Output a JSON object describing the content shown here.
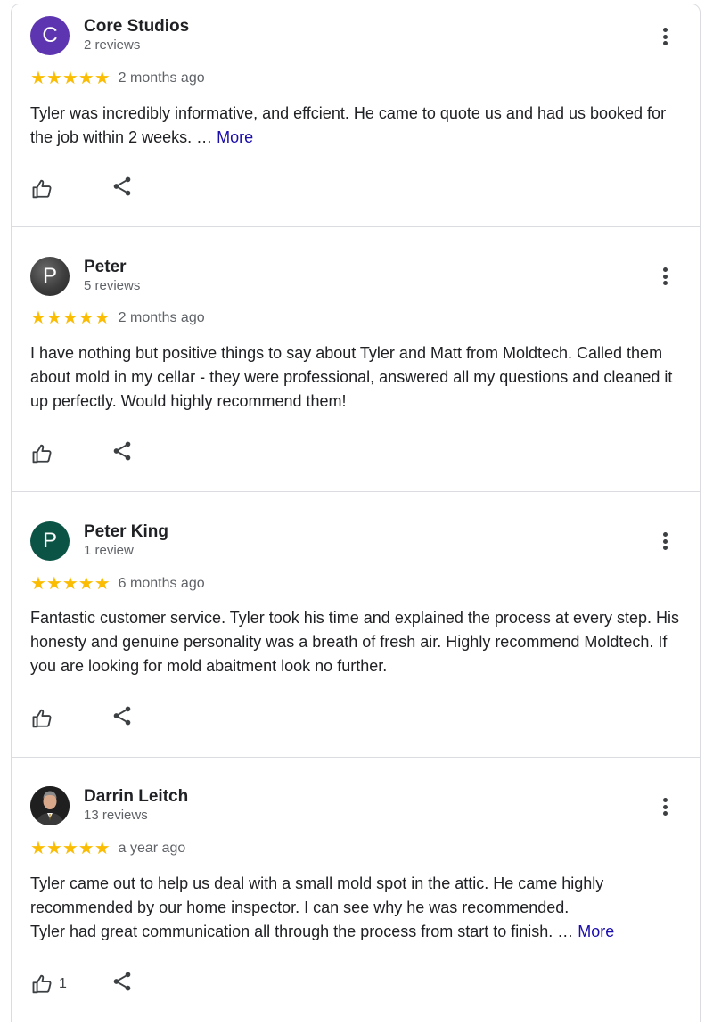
{
  "reviews": [
    {
      "avatar_letter": "C",
      "avatar_color": "#5e35b1",
      "name": "Core Studios",
      "review_count": "2 reviews",
      "rating": 5,
      "stars": "★★★★★",
      "time": "2 months ago",
      "text": "Tyler was incredibly informative, and effcient. He came to quote us and had us booked for the job within 2 weeks. … ",
      "more": "More",
      "likes": ""
    },
    {
      "avatar_letter": "P",
      "avatar_color": "#3d3d3d",
      "name": "Peter",
      "review_count": "5 reviews",
      "rating": 5,
      "stars": "★★★★★",
      "time": "2 months ago",
      "text": "I have nothing but positive things to say about Tyler and Matt from Moldtech. Called them about mold in my cellar - they were professional, answered all my questions and cleaned it up perfectly. Would highly recommend them!",
      "more": "",
      "likes": ""
    },
    {
      "avatar_letter": "P",
      "avatar_color": "#0b5445",
      "name": "Peter King",
      "review_count": "1 review",
      "rating": 5,
      "stars": "★★★★★",
      "time": "6 months ago",
      "text": "Fantastic customer service. Tyler took his time and explained the process at every step. His honesty and genuine personality was a breath of fresh air. Highly recommend Moldtech. If you are looking for mold abaitment look no further.",
      "more": "",
      "likes": ""
    },
    {
      "avatar_letter": "",
      "avatar_color": "#2a2a2a",
      "name": "Darrin Leitch",
      "review_count": "13 reviews",
      "rating": 5,
      "stars": "★★★★★",
      "time": "a year ago",
      "text_line1": "Tyler came out to help us deal with a small mold spot in the attic. He came highly recommended by our home inspector. I can see why he was recommended.",
      "text_line2": "Tyler had great communication all through the process from start to finish. … ",
      "more": "More",
      "likes": "1"
    }
  ],
  "icons": {
    "avatar_photo": "person-photo",
    "menu": "more-vert-icon",
    "like": "thumb-up-icon",
    "share": "share-icon"
  },
  "colors": {
    "star": "#fbbc04",
    "link": "#1a0dab",
    "divider": "#dadce0"
  }
}
